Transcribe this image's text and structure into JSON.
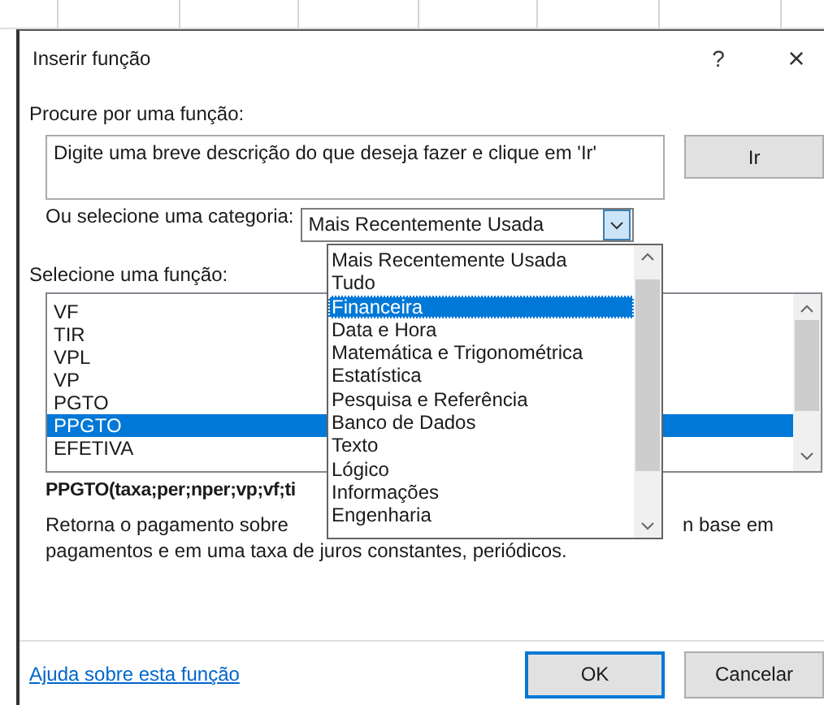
{
  "window": {
    "title": "Inserir função",
    "help_button": "?",
    "close_button": "×"
  },
  "search": {
    "label": "Procure por uma função:",
    "placeholder": "Digite uma breve descrição do que deseja fazer e clique em 'Ir'",
    "button": "Ir"
  },
  "category": {
    "label": "Ou selecione uma categoria:",
    "value": "Mais Recentemente Usada",
    "expanded": true,
    "options": [
      {
        "label": "Mais Recentemente Usada",
        "highlighted": false
      },
      {
        "label": "Tudo",
        "highlighted": false
      },
      {
        "label": "Financeira",
        "highlighted": true
      },
      {
        "label": "Data e Hora",
        "highlighted": false
      },
      {
        "label": "Matemática e Trigonométrica",
        "highlighted": false
      },
      {
        "label": "Estatística",
        "highlighted": false
      },
      {
        "label": "Pesquisa e Referência",
        "highlighted": false
      },
      {
        "label": "Banco de Dados",
        "highlighted": false
      },
      {
        "label": "Texto",
        "highlighted": false
      },
      {
        "label": "Lógico",
        "highlighted": false
      },
      {
        "label": "Informações",
        "highlighted": false
      },
      {
        "label": "Engenharia",
        "highlighted": false
      }
    ]
  },
  "functions": {
    "label": "Selecione uma função:",
    "items": [
      {
        "name": "VF",
        "selected": false
      },
      {
        "name": "TIR",
        "selected": false
      },
      {
        "name": "VPL",
        "selected": false
      },
      {
        "name": "VP",
        "selected": false
      },
      {
        "name": "PGTO",
        "selected": false
      },
      {
        "name": "PPGTO",
        "selected": true
      },
      {
        "name": "EFETIVA",
        "selected": false
      }
    ]
  },
  "signature": "PPGTO(taxa;per;nper;vp;vf;ti",
  "description": {
    "line_1_start": "Retorna o pagamento sobre",
    "line_1_end": "n base em",
    "line_2": "pagamentos e em uma taxa de juros constantes, periódicos."
  },
  "help_link": "Ajuda sobre esta função",
  "buttons": [
    "OK",
    "Cancelar"
  ]
}
